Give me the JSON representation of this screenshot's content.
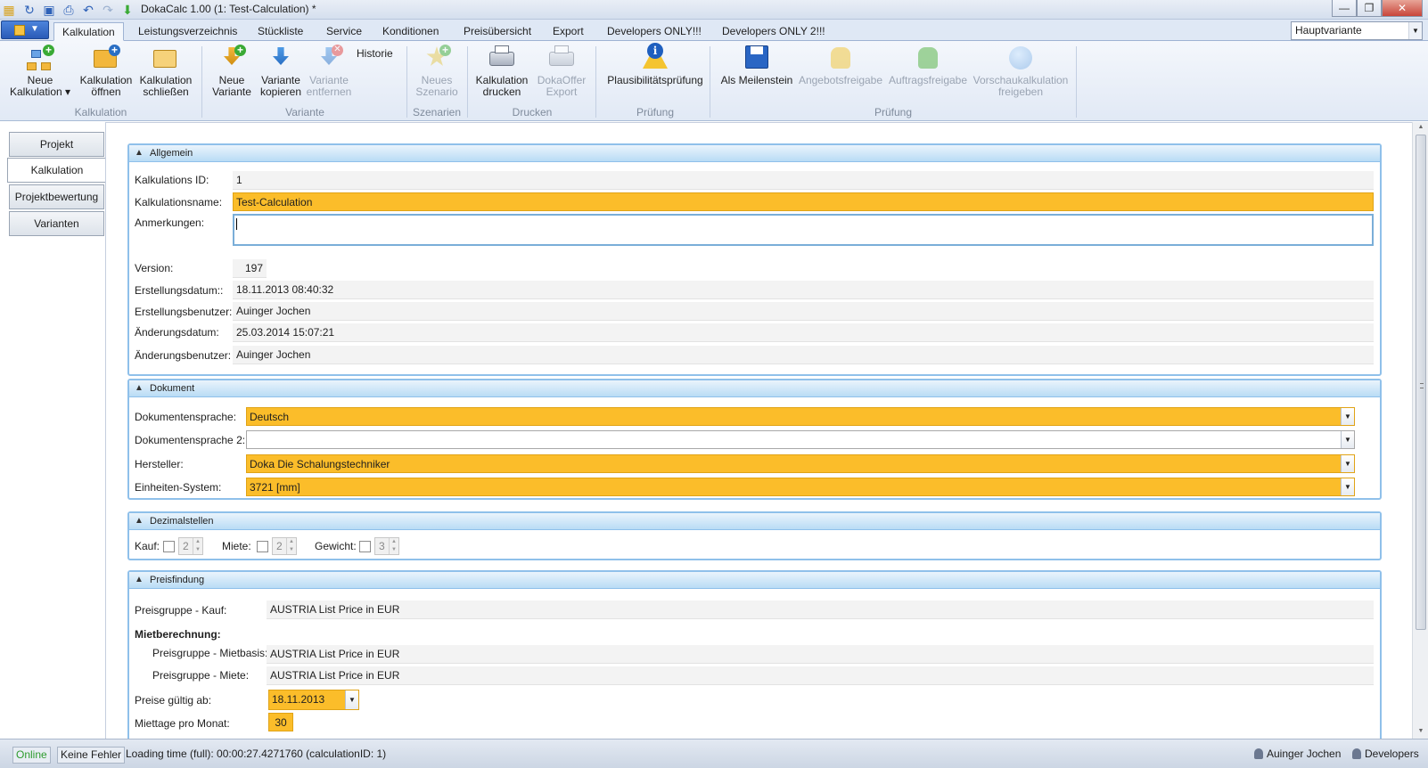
{
  "window": {
    "title": "DokaCalc 1.00 (1: Test-Calculation) *",
    "minimize_glyph": "—",
    "maximize_glyph": "❐",
    "close_glyph": "✕"
  },
  "tabs": [
    "Kalkulation",
    "Leistungsverzeichnis",
    "Stückliste",
    "Service",
    "Konditionen",
    "Preisübersicht",
    "Export",
    "Developers ONLY!!!",
    "Developers ONLY 2!!!"
  ],
  "variant_select": {
    "value": "Hauptvariante"
  },
  "ribbon": {
    "neue_kalkulation": "Neue\nKalkulation ▾",
    "kalkulation_oeffnen": "Kalkulation\nöffnen",
    "kalkulation_schliessen": "Kalkulation\nschließen",
    "group_kalkulation": "Kalkulation",
    "neue_variante": "Neue\nVariante",
    "variante_kopieren": "Variante\nkopieren",
    "variante_entfernen": "Variante\nentfernen",
    "historie": "Historie",
    "group_variante": "Variante",
    "neues_szenario": "Neues\nSzenario",
    "group_szenarien": "Szenarien",
    "kalkulation_drucken": "Kalkulation\ndrucken",
    "dokaoffer_export": "DokaOffer\nExport",
    "group_drucken": "Drucken",
    "plausibilitaet": "Plausibilitätsprüfung",
    "group_pruefung1": "Prüfung",
    "als_meilenstein": "Als Meilenstein",
    "angebotsfreigabe": "Angebotsfreigabe",
    "auftragsfreigabe": "Auftragsfreigabe",
    "vorschau": "Vorschaukalkulation\nfreigeben",
    "group_pruefung2": "Prüfung"
  },
  "leftnav": [
    "Projekt",
    "Kalkulation",
    "Projektbewertung",
    "Varianten"
  ],
  "allgemein": {
    "header": "Allgemein",
    "id_label": "Kalkulations ID:",
    "id_value": "1",
    "name_label": "Kalkulationsname:",
    "name_value": "Test-Calculation",
    "notes_label": "Anmerkungen:",
    "version_label": "Version:",
    "version_value": "197",
    "created_label": "Erstellungsdatum::",
    "created_value": "18.11.2013 08:40:32",
    "creator_label": "Erstellungsbenutzer:",
    "creator_value": "Auinger Jochen",
    "changed_label": "Änderungsdatum:",
    "changed_value": "25.03.2014 15:07:21",
    "changer_label": "Änderungsbenutzer:",
    "changer_value": "Auinger Jochen"
  },
  "dokument": {
    "header": "Dokument",
    "lang_label": "Dokumentensprache:",
    "lang_value": "Deutsch",
    "lang2_label": "Dokumentensprache 2:",
    "lang2_value": "",
    "maker_label": "Hersteller:",
    "maker_value": "Doka Die Schalungstechniker",
    "units_label": "Einheiten-System:",
    "units_value": "3721 [mm]"
  },
  "dezimal": {
    "header": "Dezimalstellen",
    "kauf_label": "Kauf:",
    "kauf_value": "2",
    "miete_label": "Miete:",
    "miete_value": "2",
    "gewicht_label": "Gewicht:",
    "gewicht_value": "3"
  },
  "preis": {
    "header": "Preisfindung",
    "kauf_label": "Preisgruppe - Kauf:",
    "kauf_value": "AUSTRIA List Price in EUR",
    "miet_header": "Mietberechnung:",
    "mietbasis_label": "Preisgruppe - Mietbasis:",
    "mietbasis_value": "AUSTRIA List Price in EUR",
    "miete_label": "Preisgruppe - Miete:",
    "miete_value": "AUSTRIA List Price in EUR",
    "valid_label": "Preise gültig ab:",
    "valid_value": "18.11.2013",
    "days_label": "Miettage pro Monat:",
    "days_value": "30"
  },
  "status": {
    "online": "Online",
    "errors": "Keine Fehler",
    "loading": "Loading time (full): 00:00:27.4271760 (calculationID: 1)",
    "user": "Auinger Jochen",
    "group": "Developers"
  },
  "colors": {
    "required": "#fbbd2a",
    "panel_border": "#8fc0ea",
    "online": "#2e9b2e"
  }
}
